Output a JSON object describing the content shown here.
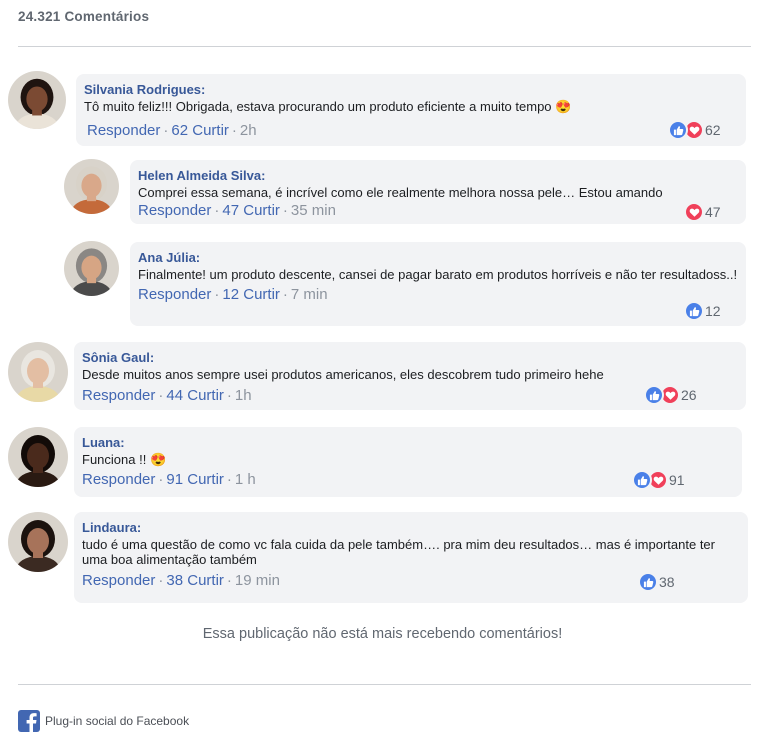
{
  "header": {
    "count_label": "24.321 Comentários"
  },
  "action_labels": {
    "reply": "Responder",
    "separator": "·"
  },
  "comments": [
    {
      "author": "Silvania Rodrigues:",
      "text": "Tô muito feliz!!! Obrigada, estava procurando um produto eficiente a muito tempo",
      "emoji": "😍",
      "likes": "62 Curtir",
      "time": "2h",
      "reactions": [
        "like",
        "love"
      ],
      "reaction_count": "62",
      "skin": "#7b4a33",
      "hair": "#1f1410",
      "shirt": "#eae3d8"
    },
    {
      "author": "Helen Almeida Silva:",
      "text": "Comprei essa semana, é incrível como ele realmente melhora nossa pele… Estou amando",
      "emoji": "",
      "likes": "47 Curtir",
      "time": "35 min",
      "reactions": [
        "love"
      ],
      "reaction_count": "47",
      "skin": "#d9a88a",
      "hair": "#d8d2c8",
      "shirt": "#c46a3a"
    },
    {
      "author": "Ana Júlia:",
      "text": "Finalmente! um produto descente, cansei de pagar barato em produtos horríveis e não ter resultadoss..!",
      "emoji": "",
      "likes": "12 Curtir",
      "time": "7 min",
      "reactions": [
        "like"
      ],
      "reaction_count": "12",
      "skin": "#d6a584",
      "hair": "#8a8784",
      "shirt": "#4b4b4b"
    },
    {
      "author": "Sônia Gaul:",
      "text": "Desde muitos anos sempre usei produtos americanos, eles descobrem tudo primeiro hehe",
      "emoji": "",
      "likes": "44 Curtir",
      "time": "1h",
      "reactions": [
        "like",
        "love"
      ],
      "reaction_count": "26",
      "skin": "#e3bea3",
      "hair": "#e9e6e0",
      "shirt": "#e8d9a6"
    },
    {
      "author": "Luana:",
      "text": "Funciona !!",
      "emoji": "😍",
      "likes": "91 Curtir",
      "time": "1 h",
      "reactions": [
        "like",
        "love"
      ],
      "reaction_count": "91",
      "skin": "#4a2a1c",
      "hair": "#120b08",
      "shirt": "#2a1a12"
    },
    {
      "author": "Lindaura:",
      "text": "tudo é uma questão de como vc fala cuida da pele também…. pra mim deu resultados… mas é importante ter uma boa alimentação também",
      "emoji": "",
      "likes": "38 Curtir",
      "time": "19 min",
      "reactions": [
        "like"
      ],
      "reaction_count": "38",
      "skin": "#a7735a",
      "hair": "#1b120e",
      "shirt": "#3b2a22"
    }
  ],
  "closed_notice": "Essa publicação não está mais recebendo comentários!",
  "footer": {
    "label": "Plug-in social do Facebook",
    "icon": "facebook-icon",
    "brand_color": "#4267b2"
  },
  "colors": {
    "link": "#4267b2",
    "author": "#385898",
    "bubble": "#f2f3f5",
    "like": "#4a80e8",
    "love": "#f0405a"
  }
}
